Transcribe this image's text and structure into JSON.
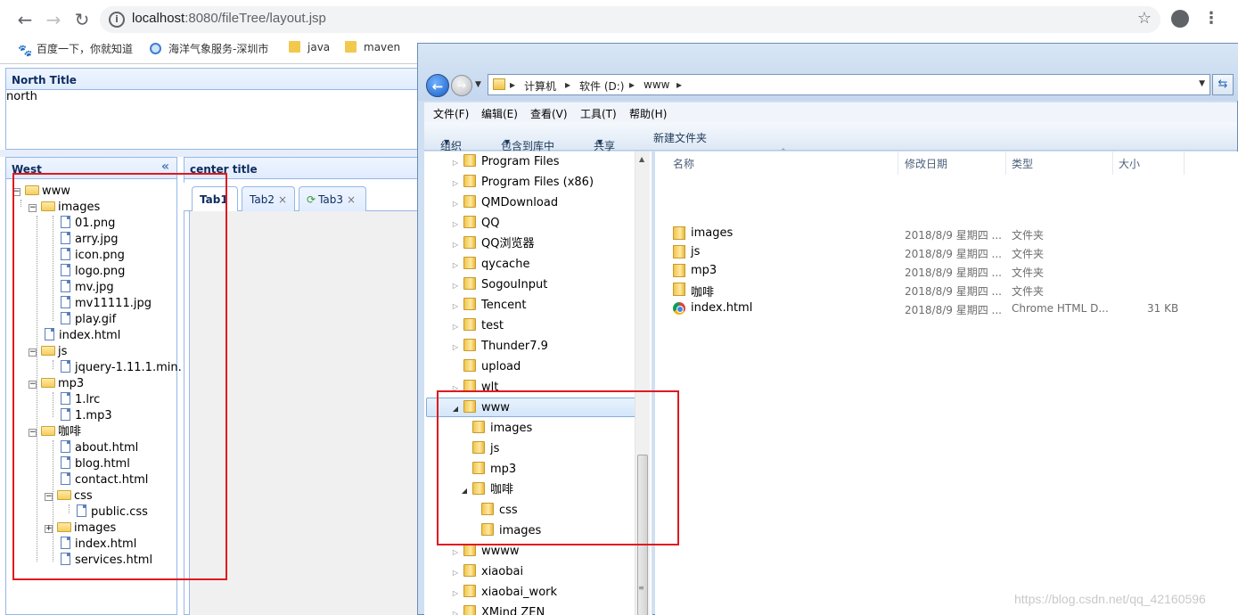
{
  "browser": {
    "url_host": "localhost",
    "url_path": ":8080/fileTree/layout.jsp",
    "bookmarks": [
      "百度一下，你就知道",
      "海洋气象服务-深圳市",
      "java",
      "maven"
    ]
  },
  "layout": {
    "north_title": "North Title",
    "north_text": "north",
    "west_title": "West",
    "center_title": "center title",
    "tabs": [
      "Tab1",
      "Tab2",
      "Tab3"
    ],
    "tab_close": "×",
    "tree": [
      "www",
      "images",
      "01.png",
      "arry.jpg",
      "icon.png",
      "logo.png",
      "mv.jpg",
      "mv11111.jpg",
      "play.gif",
      "index.html",
      "js",
      "jquery-1.11.1.min.",
      "mp3",
      "1.lrc",
      "1.mp3",
      "咖啡",
      "about.html",
      "blog.html",
      "contact.html",
      "css",
      "public.css",
      "images",
      "index.html",
      "services.html"
    ]
  },
  "explorer": {
    "breadcrumb": [
      "计算机",
      "软件 (D:)",
      "www"
    ],
    "menu": [
      "文件(F)",
      "编辑(E)",
      "查看(V)",
      "工具(T)",
      "帮助(H)"
    ],
    "commands": [
      "组织",
      "包含到库中",
      "共享",
      "新建文件夹"
    ],
    "nav": [
      "Program Files",
      "Program Files (x86)",
      "QMDownload",
      "QQ",
      "QQ浏览器",
      "qycache",
      "SogouInput",
      "Tencent",
      "test",
      "Thunder7.9",
      "upload",
      "wlt",
      "www",
      "images",
      "js",
      "mp3",
      "咖啡",
      "css",
      "images",
      "wwww",
      "xiaobai",
      "xiaobai_work",
      "XMind ZEN"
    ],
    "columns": [
      "名称",
      "修改日期",
      "类型",
      "大小"
    ],
    "files": [
      {
        "name": "images",
        "date": "2018/8/9 星期四 ...",
        "type": "文件夹",
        "size": ""
      },
      {
        "name": "js",
        "date": "2018/8/9 星期四 ...",
        "type": "文件夹",
        "size": ""
      },
      {
        "name": "mp3",
        "date": "2018/8/9 星期四 ...",
        "type": "文件夹",
        "size": ""
      },
      {
        "name": "咖啡",
        "date": "2018/8/9 星期四 ...",
        "type": "文件夹",
        "size": ""
      },
      {
        "name": "index.html",
        "date": "2018/8/9 星期四 ...",
        "type": "Chrome HTML D...",
        "size": "31 KB"
      }
    ]
  },
  "watermark": "https://blog.csdn.net/qq_42160596",
  "colors": {
    "easyui_border": "#95b8e7",
    "highlight_box": "#e0191f",
    "explorer_frame": "#cfe0f3"
  }
}
